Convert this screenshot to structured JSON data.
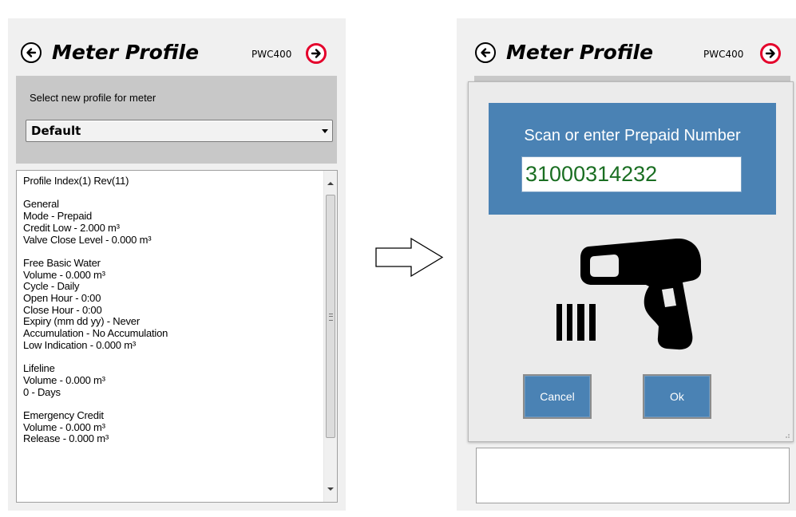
{
  "left": {
    "title": "Meter Profile",
    "model": "PWC400",
    "select_label": "Select new profile for meter",
    "profile_value": "Default",
    "details_lines": [
      "Profile Index(1) Rev(11)",
      "",
      "General",
      "Mode - Prepaid",
      "Credit Low - 2.000 m³",
      "Valve Close Level - 0.000 m³",
      "",
      "Free Basic Water",
      "Volume - 0.000 m³",
      "Cycle - Daily",
      "Open Hour - 0:00",
      "Close Hour - 0:00",
      "Expiry (mm dd yy) - Never",
      "Accumulation - No Accumulation",
      "Low Indication - 0.000 m³",
      "",
      "Lifeline",
      "Volume - 0.000 m³",
      "0 - Days",
      "",
      "Emergency Credit",
      "Volume - 0.000 m³",
      "Release - 0.000 m³"
    ],
    "icons": {
      "back": "back-arrow-icon",
      "forward": "forward-arrow-icon"
    }
  },
  "right": {
    "title": "Meter Profile",
    "model": "PWC400",
    "dialog": {
      "prompt": "Scan or enter Prepaid Number",
      "prepaid_number": "31000314232",
      "cancel_label": "Cancel",
      "ok_label": "Ok",
      "icon": "barcode-scanner-icon"
    }
  },
  "colors": {
    "accent_blue": "#4a82b4",
    "forward_red": "#e4002b",
    "input_text_green": "#1a6e22",
    "panel_bg": "#f0f0f0"
  }
}
